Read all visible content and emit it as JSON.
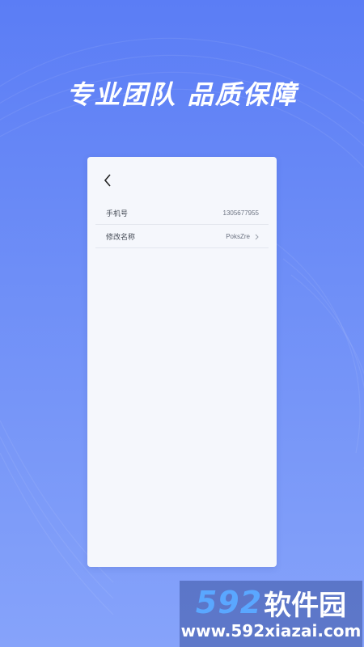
{
  "headline": "专业团队 品质保障",
  "screen": {
    "back_icon": "chevron-left-icon",
    "rows": [
      {
        "label": "手机号",
        "value": "1305677955"
      },
      {
        "label": "修改名称",
        "value": "PoksZre",
        "icon": "chevron-right-icon"
      }
    ]
  },
  "watermark": {
    "number": "592",
    "brand": "软件园",
    "url": "www.592xiazai.com"
  },
  "colors": {
    "background": "#5b7df5",
    "card": "#f5f7fc",
    "watermark_accent": "#5aa7ff"
  }
}
